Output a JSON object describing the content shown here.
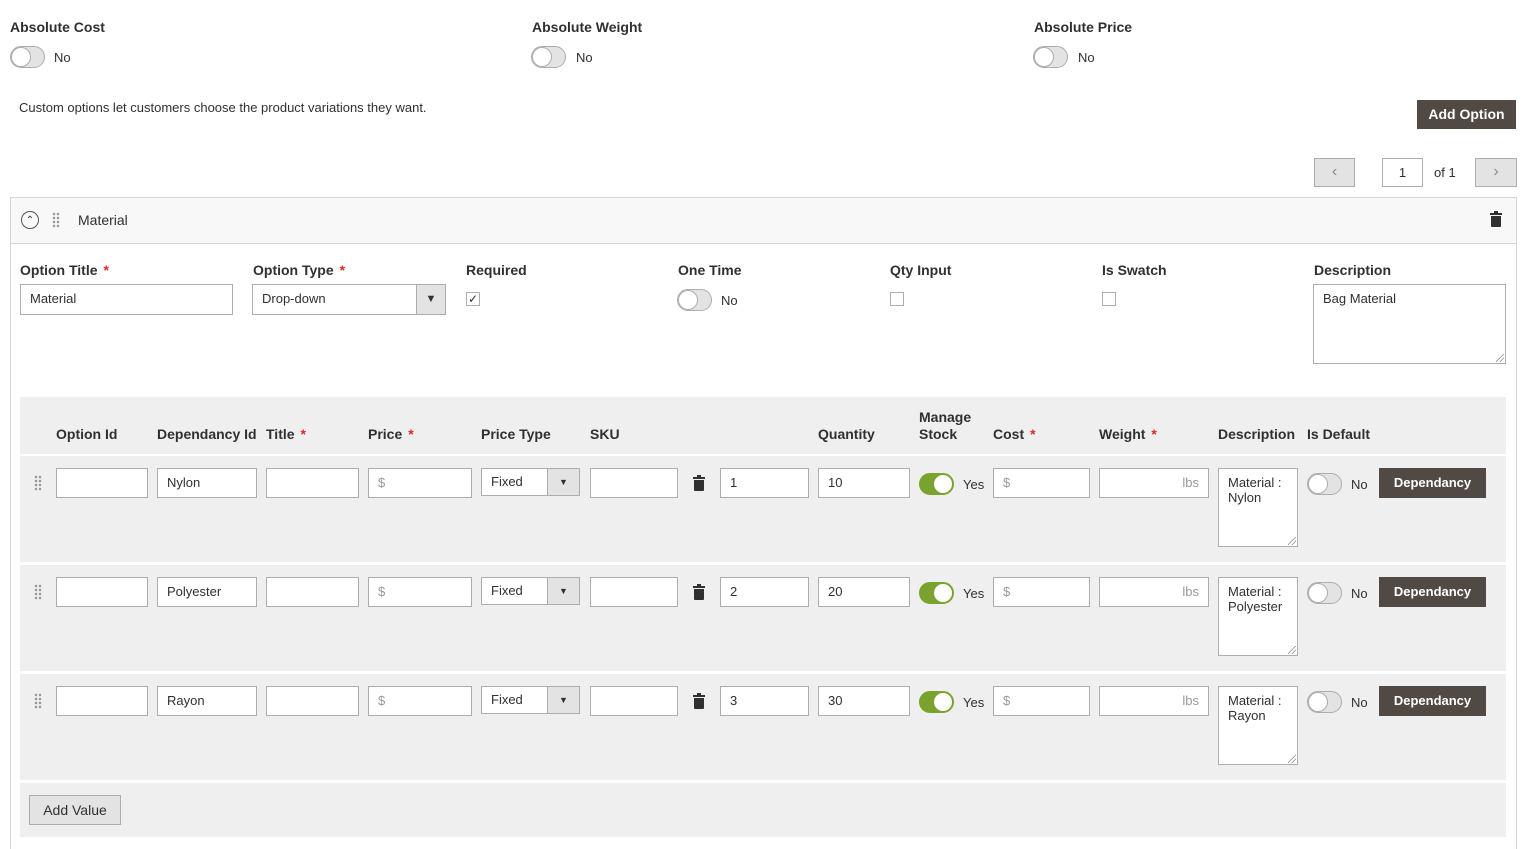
{
  "absolute": [
    {
      "label": "Absolute Cost",
      "state": "No"
    },
    {
      "label": "Absolute Weight",
      "state": "No"
    },
    {
      "label": "Absolute Price",
      "state": "No"
    }
  ],
  "intro_text": "Custom options let customers choose the product variations they want.",
  "add_option_label": "Add Option",
  "pager": {
    "page": "1",
    "of_label": "of 1"
  },
  "option": {
    "name": "Material",
    "fields": {
      "title_label": "Option Title",
      "title_value": "Material",
      "type_label": "Option Type",
      "type_value": "Drop-down",
      "required_label": "Required",
      "required_checked": true,
      "one_time_label": "One Time",
      "one_time_state": "No",
      "qty_input_label": "Qty Input",
      "is_swatch_label": "Is Swatch",
      "description_label": "Description",
      "description_value": "Bag Material"
    }
  },
  "grid": {
    "headers": {
      "option_id": "Option Id",
      "dependancy_id": "Dependancy Id",
      "title": "Title",
      "price": "Price",
      "price_type": "Price Type",
      "sku": "SKU",
      "quantity": "Quantity",
      "manage_stock_1": "Manage",
      "manage_stock_2": "Stock",
      "cost": "Cost",
      "weight": "Weight",
      "description": "Description",
      "is_default": "Is Default"
    },
    "rows": [
      {
        "dependancy_id": "Nylon",
        "price_symbol": "$",
        "price_type": "Fixed",
        "sort": "1",
        "quantity": "10",
        "manage_stock": "Yes",
        "cost_symbol": "$",
        "weight_unit": "lbs",
        "description": "Material : Nylon",
        "is_default": "No",
        "dependancy_button": "Dependancy"
      },
      {
        "dependancy_id": "Polyester",
        "price_symbol": "$",
        "price_type": "Fixed",
        "sort": "2",
        "quantity": "20",
        "manage_stock": "Yes",
        "cost_symbol": "$",
        "weight_unit": "lbs",
        "description": "Material : Polyester",
        "is_default": "No",
        "dependancy_button": "Dependancy"
      },
      {
        "dependancy_id": "Rayon",
        "price_symbol": "$",
        "price_type": "Fixed",
        "sort": "3",
        "quantity": "30",
        "manage_stock": "Yes",
        "cost_symbol": "$",
        "weight_unit": "lbs",
        "description": "Material : Rayon",
        "is_default": "No",
        "dependancy_button": "Dependancy"
      }
    ],
    "add_value_label": "Add Value"
  },
  "colors": {
    "accent_dark": "#514943",
    "toggle_on": "#79a22e",
    "required_star": "#e22626",
    "grid_bg": "#efefef"
  }
}
